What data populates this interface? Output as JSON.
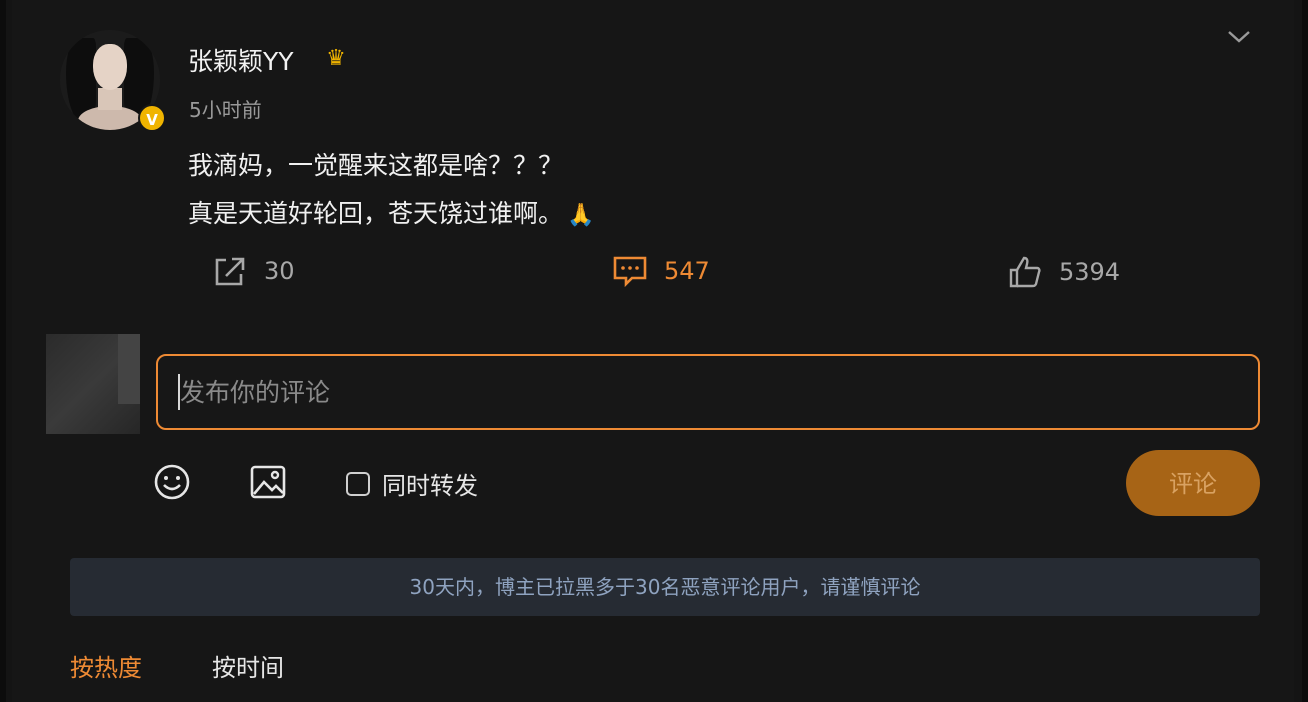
{
  "post": {
    "username": "张颖颖YY",
    "timestamp": "5小时前",
    "lines": [
      "我滴妈，一觉醒来这都是啥？？？",
      "真是天道好轮回，苍天饶过谁啊。"
    ],
    "emoji": "🙏",
    "verified_badge": "V",
    "member_icon": "crown-icon"
  },
  "actions": {
    "forward_count": "30",
    "comment_count": "547",
    "like_count": "5394"
  },
  "composer": {
    "placeholder": "发布你的评论",
    "repost_label": "同时转发",
    "submit_label": "评论"
  },
  "notice": "30天内，博主已拉黑多于30名恶意评论用户，请谨慎评论",
  "sort_tabs": [
    {
      "label": "按热度",
      "active": true
    },
    {
      "label": "按时间",
      "active": false
    }
  ],
  "colors": {
    "accent": "#ee8a34",
    "background": "#161616",
    "notice_bg": "#262b33",
    "notice_text": "#8fa3c0",
    "verified": "#f0b400"
  }
}
